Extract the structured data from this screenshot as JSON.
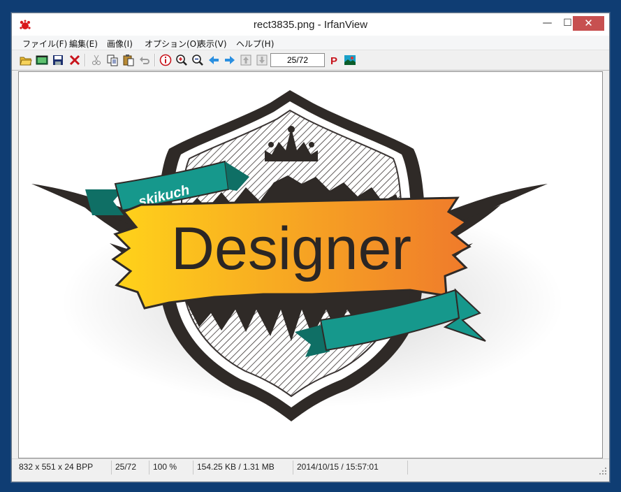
{
  "window": {
    "title": "rect3835.png - IrfanView",
    "controls": {
      "minimize": "—",
      "maximize": "☐",
      "close": "✕"
    }
  },
  "menu": [
    "ファイル(F)",
    "編集(E)",
    "画像(I)",
    "オプション(O)",
    "表示(V)",
    "ヘルプ(H)"
  ],
  "toolbar": {
    "icons": [
      "open-folder-icon",
      "slideshow-icon",
      "save-icon",
      "delete-icon",
      "cut-icon",
      "copy-icon",
      "paste-icon",
      "undo-icon",
      "info-icon",
      "zoom-in-icon",
      "zoom-out-icon",
      "previous-arrow-icon",
      "next-arrow-icon",
      "first-file-icon",
      "last-file-icon",
      "print-icon",
      "about-icon"
    ],
    "page_indicator": "25/72"
  },
  "image": {
    "banner_text": "Designer",
    "ribbon_text": "skikuch",
    "colors": {
      "banner_start": "#ffd31a",
      "banner_end": "#ef7a2b",
      "ribbon": "#16988c",
      "outline": "#2f2a27"
    }
  },
  "status": {
    "dimensions": "832 x 551 x 24 BPP",
    "index": "25/72",
    "zoom": "100 %",
    "size": "154.25 KB / 1.31 MB",
    "datetime": "2014/10/15 / 15:57:01"
  }
}
